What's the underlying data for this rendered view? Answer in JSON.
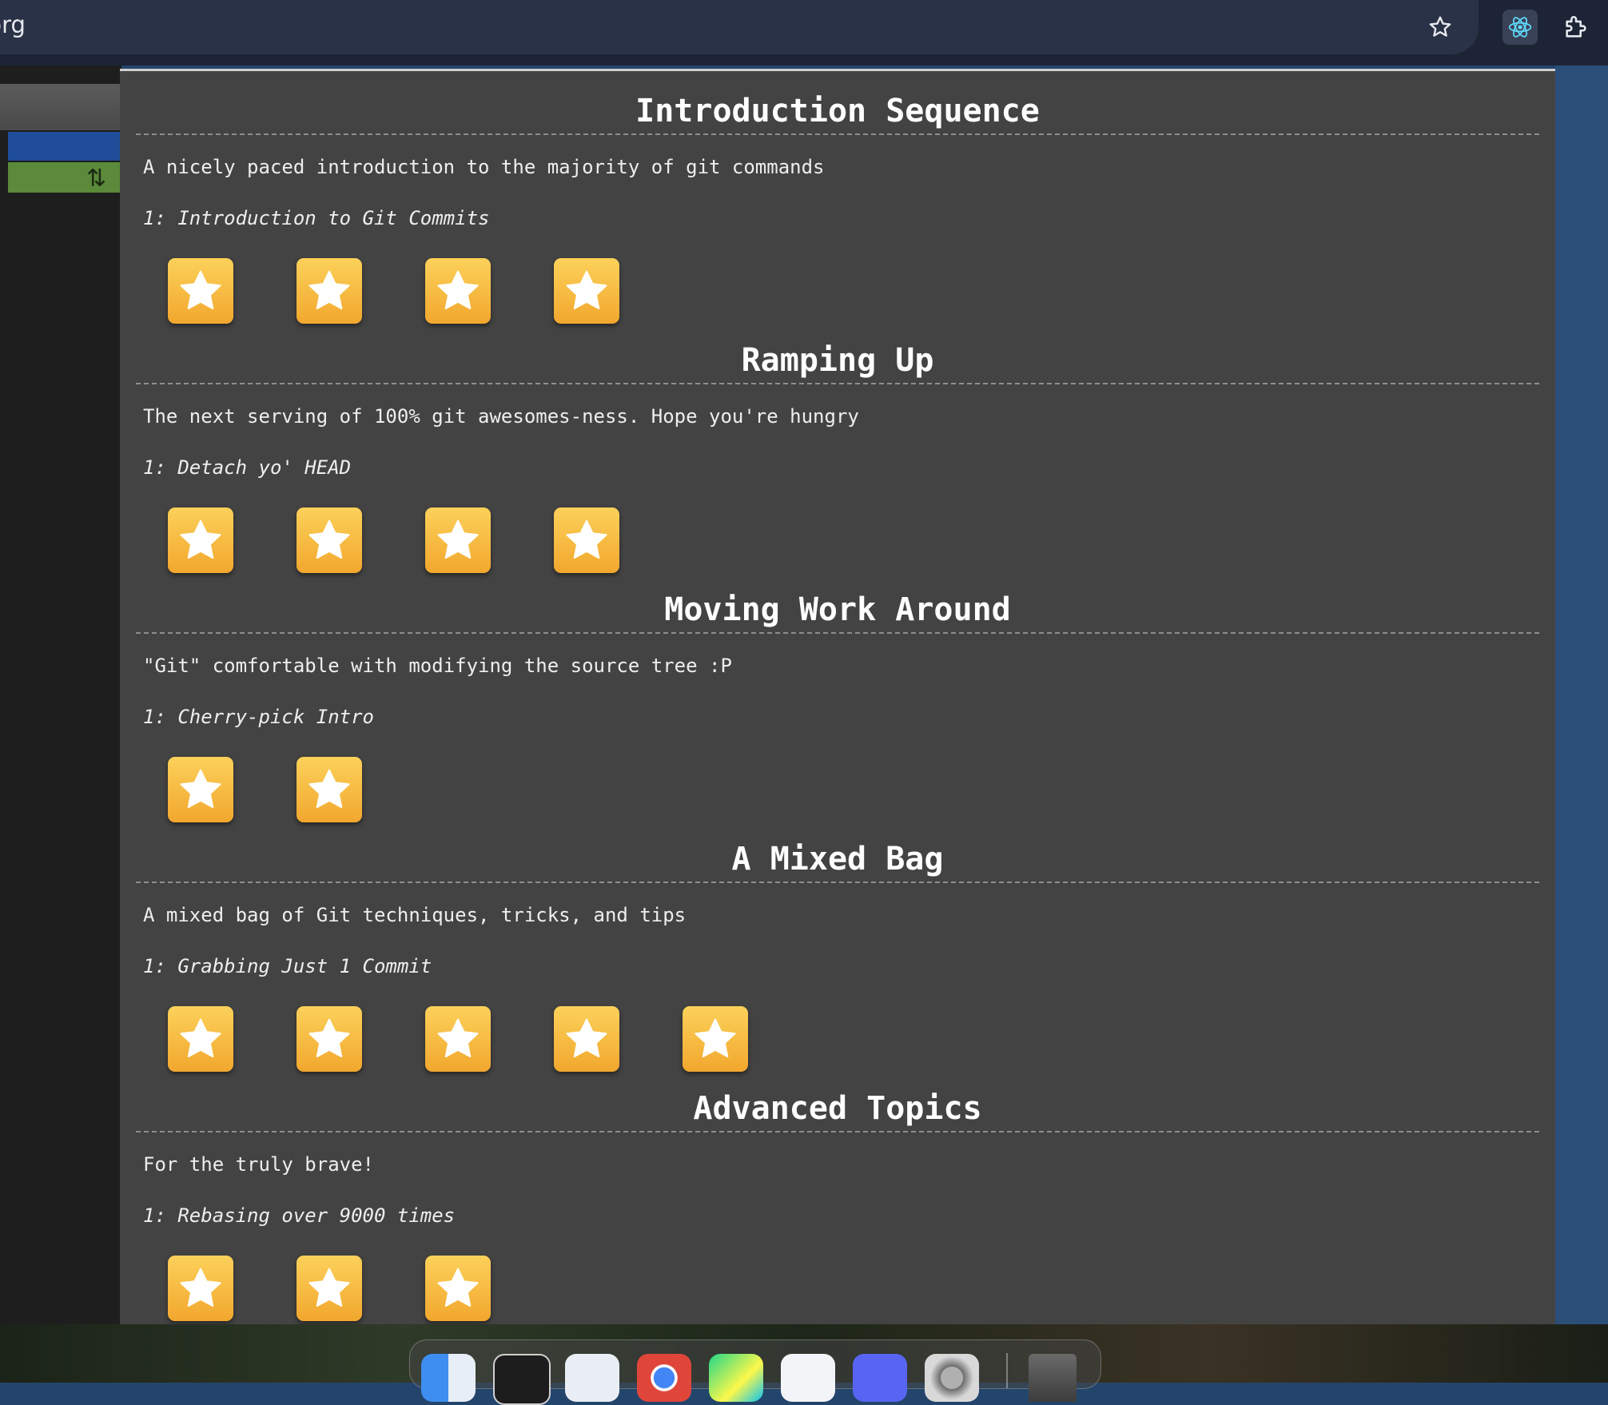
{
  "browser": {
    "url_fragment": "s.org",
    "icons": [
      "bookmark-star-icon",
      "react-devtools-icon",
      "extensions-puzzle-icon"
    ]
  },
  "colors": {
    "star_top": "#fcd15a",
    "star_bottom": "#f2a72e",
    "modal_bg": "#434343"
  },
  "sections": [
    {
      "title": "Introduction Sequence",
      "description": "A nicely paced introduction to the majority of git commands",
      "selected_level": "1: Introduction to Git Commits",
      "star_count": 4
    },
    {
      "title": "Ramping Up",
      "description": "The next serving of 100% git awesomes-ness. Hope you're hungry",
      "selected_level": "1: Detach yo' HEAD",
      "star_count": 4
    },
    {
      "title": "Moving Work Around",
      "description": "\"Git\" comfortable with modifying the source tree :P",
      "selected_level": "1: Cherry-pick Intro",
      "star_count": 2
    },
    {
      "title": "A Mixed Bag",
      "description": "A mixed bag of Git techniques, tricks, and tips",
      "selected_level": "1: Grabbing Just 1 Commit",
      "star_count": 5
    },
    {
      "title": "Advanced Topics",
      "description": "For the truly brave!",
      "selected_level": "1: Rebasing over 9000 times",
      "star_count": 3
    }
  ],
  "dock": {
    "apps": [
      "finder-icon",
      "terminal-icon",
      "telegram-icon",
      "chrome-icon",
      "pycharm-icon",
      "vscode-icon",
      "discord-icon",
      "system-settings-icon"
    ],
    "trash": "trash-icon"
  }
}
